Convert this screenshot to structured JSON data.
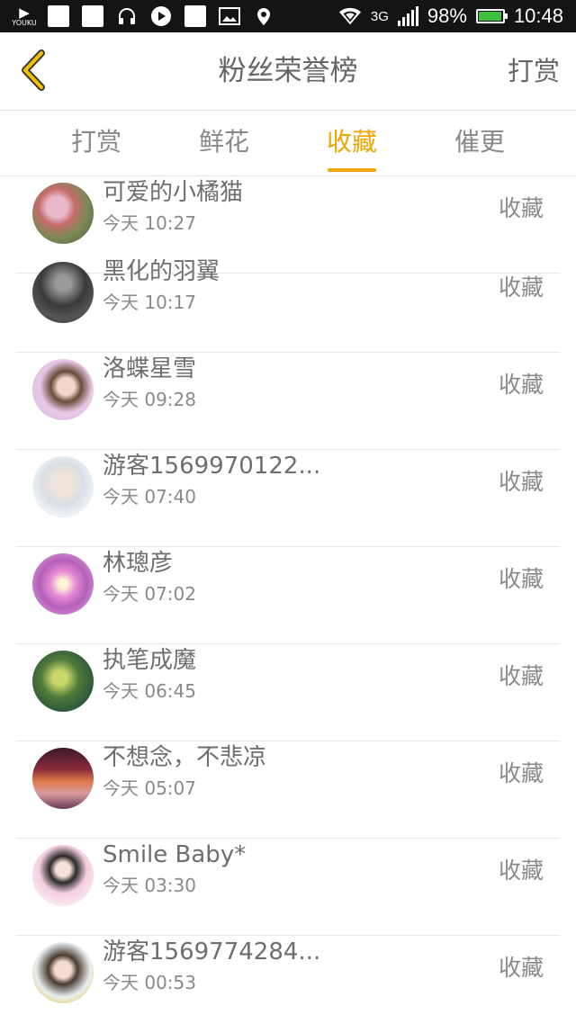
{
  "status_bar": {
    "youku_label": "YOUKU",
    "network": "3G",
    "battery": "98%",
    "battery_level": 0.98,
    "time": "10:48"
  },
  "header": {
    "title": "粉丝荣誉榜",
    "action": "打赏",
    "back_icon": "chevron-left-icon",
    "accent_color": "#f0a500"
  },
  "tabs": [
    {
      "label": "打赏",
      "active": false
    },
    {
      "label": "鲜花",
      "active": false
    },
    {
      "label": "收藏",
      "active": true
    },
    {
      "label": "催更",
      "active": false
    }
  ],
  "list": [
    {
      "name": "可爱的小橘猫",
      "time": "今天 10:27",
      "action": "收藏"
    },
    {
      "name": "黑化的羽翼",
      "time": "今天 10:17",
      "action": "收藏"
    },
    {
      "name": "洛蝶星雪",
      "time": "今天 09:28",
      "action": "收藏"
    },
    {
      "name": "游客1569970122...",
      "time": "今天 07:40",
      "action": "收藏"
    },
    {
      "name": "林璁彦",
      "time": "今天 07:02",
      "action": "收藏"
    },
    {
      "name": "执笔成魔",
      "time": "今天 06:45",
      "action": "收藏"
    },
    {
      "name": "不想念，不悲凉",
      "time": "今天 05:07",
      "action": "收藏"
    },
    {
      "name": "Smile Baby*",
      "time": "今天 03:30",
      "action": "收藏"
    },
    {
      "name": "游客1569774284...",
      "time": "今天 00:53",
      "action": "收藏"
    }
  ]
}
